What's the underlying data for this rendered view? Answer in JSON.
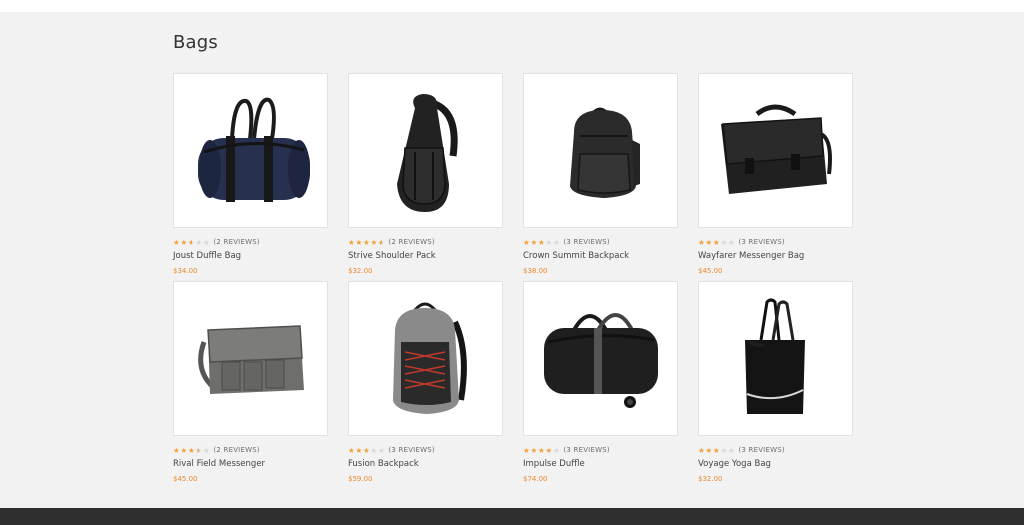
{
  "page": {
    "title": "Bags"
  },
  "colors": {
    "star": "#f0a13a",
    "price": "#e98a2c",
    "footer": "#2f2f2f",
    "background": "#f2f2f2"
  },
  "products": [
    {
      "name": "Joust Duffle Bag",
      "reviews": "(2 REVIEWS)",
      "price": "$34.00",
      "rating": 2.5,
      "image": "navy-duffle-bag-icon"
    },
    {
      "name": "Strive Shoulder Pack",
      "reviews": "(2 REVIEWS)",
      "price": "$32.00",
      "rating": 4.5,
      "image": "sling-shoulder-pack-icon"
    },
    {
      "name": "Crown Summit Backpack",
      "reviews": "(3 REVIEWS)",
      "price": "$38.00",
      "rating": 3,
      "image": "backpack-icon"
    },
    {
      "name": "Wayfarer Messenger Bag",
      "reviews": "(3 REVIEWS)",
      "price": "$45.00",
      "rating": 3,
      "image": "messenger-bag-icon"
    },
    {
      "name": "Rival Field Messenger",
      "reviews": "(2 REVIEWS)",
      "price": "$45.00",
      "rating": 3.5,
      "image": "grey-messenger-bag-icon"
    },
    {
      "name": "Fusion Backpack",
      "reviews": "(3 REVIEWS)",
      "price": "$59.00",
      "rating": 3,
      "image": "grey-backpack-icon"
    },
    {
      "name": "Impulse Duffle",
      "reviews": "(3 REVIEWS)",
      "price": "$74.00",
      "rating": 4,
      "image": "rolling-duffle-icon"
    },
    {
      "name": "Voyage Yoga Bag",
      "reviews": "(3 REVIEWS)",
      "price": "$32.00",
      "rating": 3,
      "image": "tote-bag-icon"
    }
  ]
}
